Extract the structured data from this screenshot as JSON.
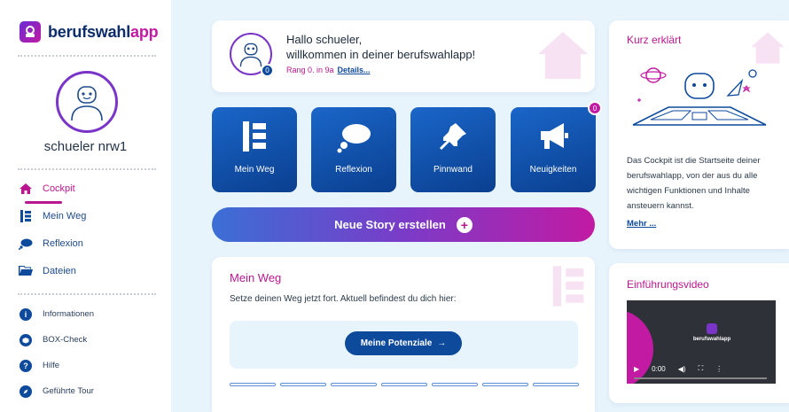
{
  "brand": {
    "name_part1": "berufswahl",
    "name_part2": "app"
  },
  "user": {
    "name": "schueler nrw1"
  },
  "nav": {
    "main": [
      {
        "label": "Cockpit",
        "icon": "home-icon",
        "active": true
      },
      {
        "label": "Mein Weg",
        "icon": "path-icon",
        "active": false
      },
      {
        "label": "Reflexion",
        "icon": "thought-bubble-icon",
        "active": false
      },
      {
        "label": "Dateien",
        "icon": "folder-icon",
        "active": false
      }
    ],
    "secondary": [
      {
        "label": "Informationen",
        "icon": "info-icon"
      },
      {
        "label": "BOX-Check",
        "icon": "box-icon"
      },
      {
        "label": "Hilfe",
        "icon": "help-icon"
      },
      {
        "label": "Geführte Tour",
        "icon": "compass-icon"
      }
    ]
  },
  "welcome": {
    "line1": "Hallo schueler,",
    "line2": "willkommen in deiner berufswahlapp!",
    "rank": "Rang 0. in 9a",
    "details_link": "Details...",
    "avatar_badge": "0"
  },
  "tiles": [
    {
      "label": "Mein Weg",
      "icon": "path-icon"
    },
    {
      "label": "Reflexion",
      "icon": "thought-bubble-icon"
    },
    {
      "label": "Pinnwand",
      "icon": "pushpin-icon"
    },
    {
      "label": "Neuigkeiten",
      "icon": "megaphone-icon"
    }
  ],
  "news_badge": "0",
  "story_button": {
    "label": "Neue Story erstellen",
    "icon": "chat-plus-icon"
  },
  "mein_weg": {
    "title": "Mein Weg",
    "subtitle": "Setze deinen Weg jetzt fort. Aktuell befindest du dich hier:",
    "button_label": "Meine Potenziale",
    "button_arrow": "→",
    "progress_steps": 7
  },
  "kurz_erklaert": {
    "title": "Kurz erklärt",
    "text": "Das Cockpit ist die Startseite deiner berufswahlapp, von der aus du alle wichtigen Funktionen und Inhalte ansteuern kannst.",
    "more_link": "Mehr ..."
  },
  "video": {
    "title": "Einführungsvideo",
    "time": "0:00",
    "brand_text": "berufswahlapp"
  },
  "colors": {
    "primary": "#0d4a9c",
    "accent": "#b8178f",
    "purple": "#7a35c8"
  }
}
